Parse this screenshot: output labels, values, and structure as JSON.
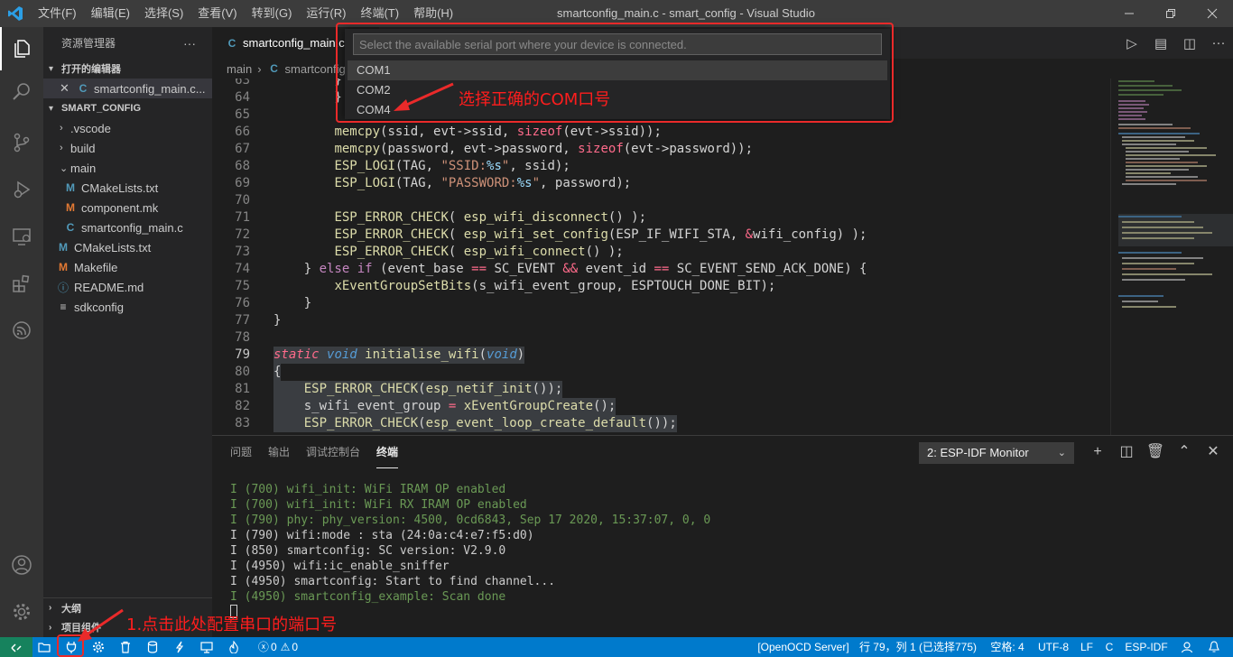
{
  "titlebar": {
    "menus": [
      "文件(F)",
      "编辑(E)",
      "选择(S)",
      "查看(V)",
      "转到(G)",
      "运行(R)",
      "终端(T)",
      "帮助(H)"
    ],
    "window_title": "smartconfig_main.c - smart_config - Visual Studio Code"
  },
  "sidebar": {
    "title": "资源管理器",
    "open_editors": "打开的编辑器",
    "open_file": "smartconfig_main.c...",
    "project": "SMART_CONFIG",
    "files": [
      ".vscode",
      "build",
      "main",
      "CMakeLists.txt",
      "component.mk",
      "smartconfig_main.c",
      "CMakeLists.txt",
      "Makefile",
      "README.md",
      "sdkconfig"
    ],
    "outline": "大纲",
    "project_components": "项目组件"
  },
  "editor": {
    "tab_label": "smartconfig_main.c",
    "breadcrumb": [
      "main",
      "smartconfig_main.c"
    ],
    "line_numbers": [
      "63",
      "64",
      "65",
      "66",
      "67",
      "68",
      "69",
      "70",
      "71",
      "72",
      "73",
      "74",
      "75",
      "76",
      "77",
      "78",
      "79",
      "80",
      "81",
      "82",
      "83"
    ],
    "current_line": "79"
  },
  "quickpick": {
    "placeholder": "Select the available serial port where your device is connected.",
    "items": [
      "COM1",
      "COM2",
      "COM4"
    ],
    "selected": "COM1"
  },
  "panel": {
    "tabs": [
      "问题",
      "输出",
      "调试控制台",
      "终端"
    ],
    "active_tab": "终端",
    "terminal_select": "2: ESP-IDF Monitor",
    "lines": [
      "I (700) wifi_init: WiFi IRAM OP enabled",
      "I (700) wifi_init: WiFi RX IRAM OP enabled",
      "I (790) phy: phy_version: 4500, 0cd6843, Sep 17 2020, 15:37:07, 0, 0",
      "I (790) wifi:mode : sta (24:0a:c4:e7:f5:d0)",
      "I (850) smartconfig: SC version: V2.9.0",
      "I (4950) wifi:ic_enable_sniffer",
      "I (4950) smartconfig: Start to find channel...",
      "I (4950) smartconfig_example: Scan done"
    ]
  },
  "statusbar": {
    "problems": "0",
    "warnings": "0",
    "openocd": "[OpenOCD Server]",
    "position": "行 79，列 1 (已选择775)",
    "spaces": "空格: 4",
    "encoding": "UTF-8",
    "eol": "LF",
    "language": "C",
    "idf": "ESP-IDF"
  },
  "annotations": {
    "com_hint": "选择正确的COM口号",
    "port_hint": "1.点击此处配置串口的端口号",
    "color": "#ea2a2a"
  },
  "colors": {
    "accent": "#007acc",
    "titlebar": "#3c3c3c",
    "activitybar": "#333333",
    "sidebar": "#252526",
    "editor": "#1e1e1e"
  }
}
